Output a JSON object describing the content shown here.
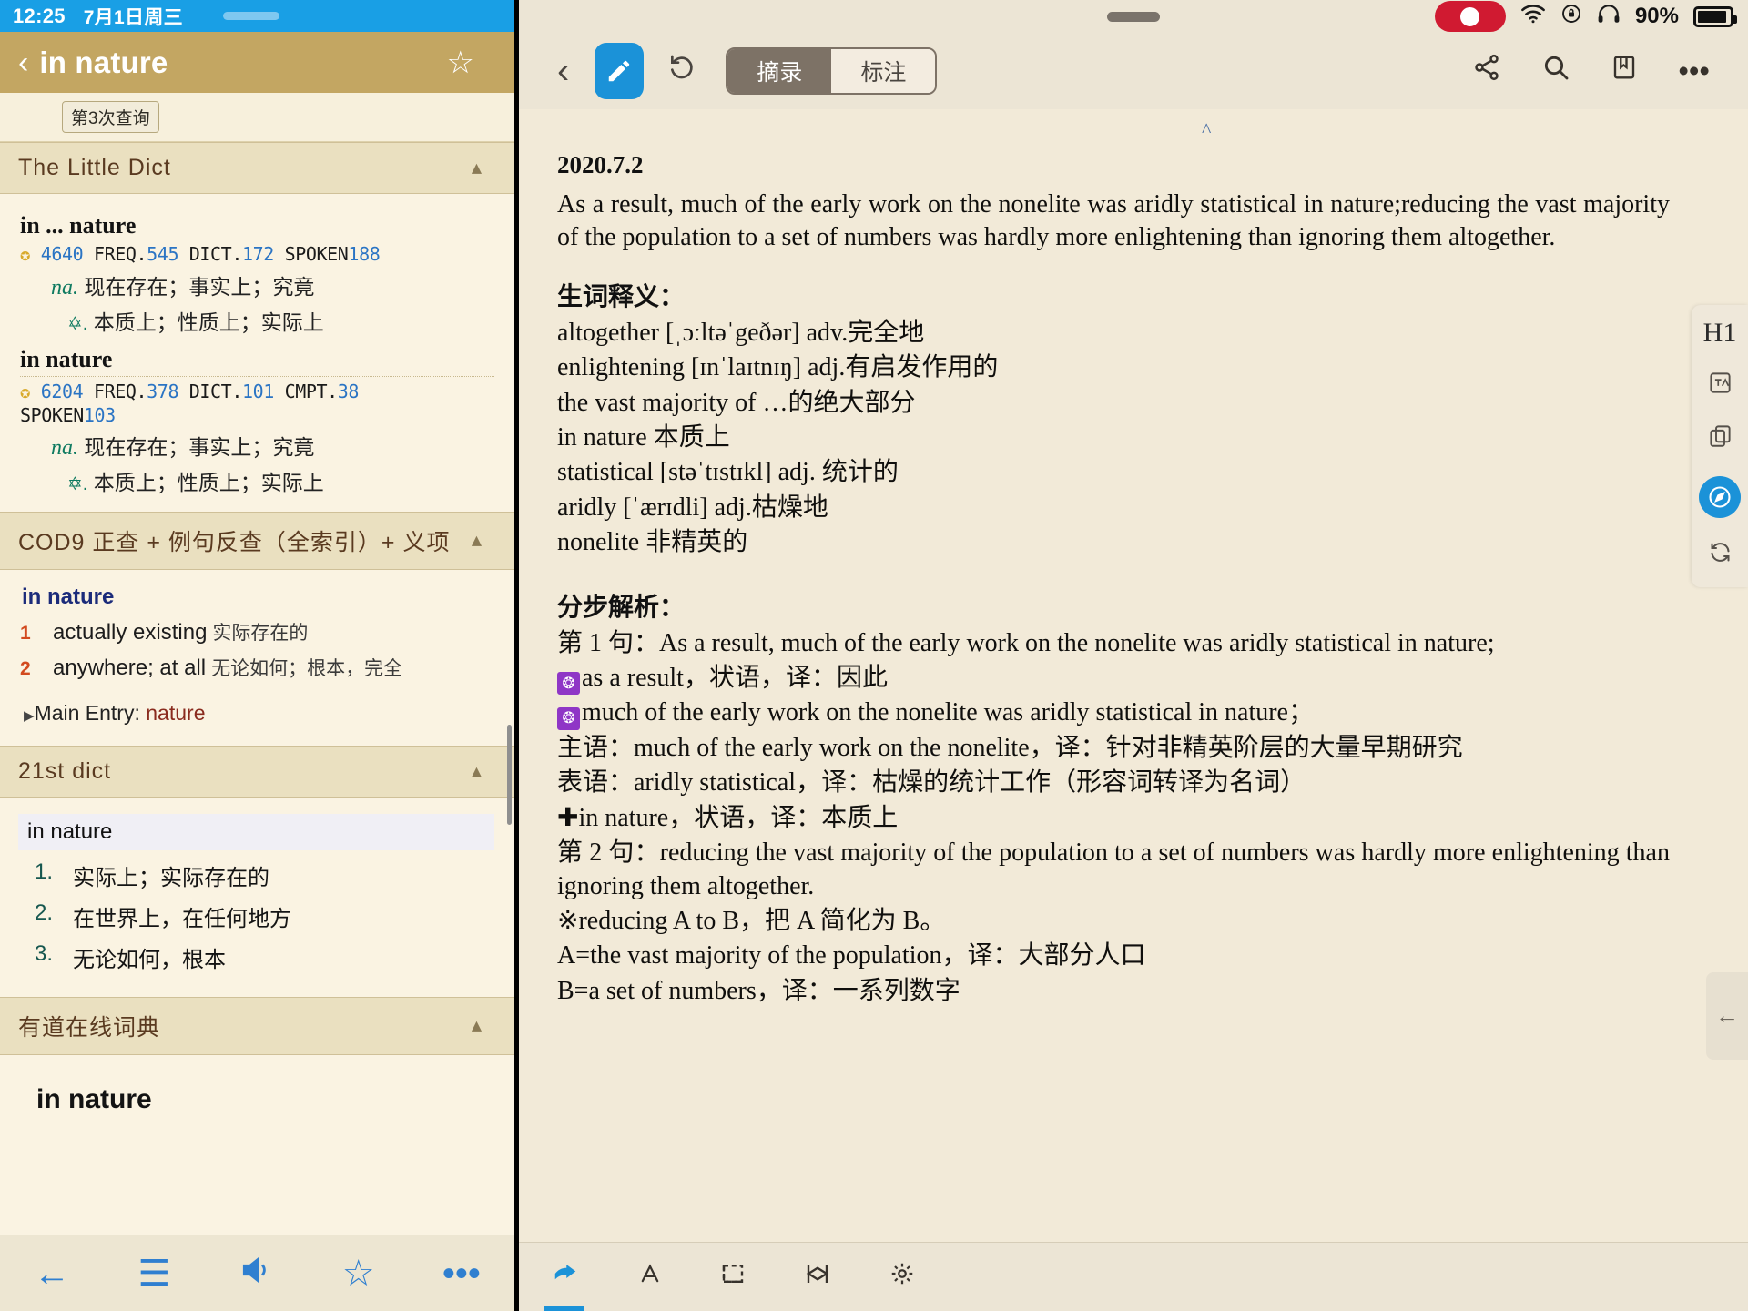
{
  "status_bar": {
    "time": "12:25",
    "date": "7月1日周三"
  },
  "dict_header": {
    "title": "in nature",
    "back_icon": "chevron-left-icon",
    "favorite_icon": "star-outline-icon"
  },
  "query": {
    "tag": "第3次查询"
  },
  "sections": [
    {
      "name": "little-dict",
      "title": "The Little Dict",
      "entries": [
        {
          "headword": "in ... nature",
          "freq": {
            "star": "4640",
            "items": [
              {
                "label": "FREQ.",
                "value": "545"
              },
              {
                "label": "DICT.",
                "value": "172"
              },
              {
                "label": "SPOKEN",
                "value": "188"
              }
            ]
          },
          "defs": [
            {
              "pos": "na.",
              "text": "现在存在；事实上；究竟"
            },
            {
              "pos": "✡.",
              "text": "本质上；性质上；实际上"
            }
          ]
        },
        {
          "headword": "in nature",
          "freq": {
            "star": "6204",
            "items": [
              {
                "label": "FREQ.",
                "value": "378"
              },
              {
                "label": "DICT.",
                "value": "101"
              },
              {
                "label": "CMPT.",
                "value": "38"
              },
              {
                "label": "SPOKEN",
                "value": "103"
              }
            ]
          },
          "defs": [
            {
              "pos": "na.",
              "text": "现在存在；事实上；究竟"
            },
            {
              "pos": "✡.",
              "text": "本质上；性质上；实际上"
            }
          ]
        }
      ]
    },
    {
      "name": "cod9",
      "title": "COD9 正查 + 例句反查（全索引）+ 义项",
      "headword": "in nature",
      "items": [
        {
          "num": "1",
          "en": "actually existing",
          "cn": "实际存在的"
        },
        {
          "num": "2",
          "en": "anywhere; at all",
          "cn": "无论如何；根本，完全"
        }
      ],
      "main_entry_label": "Main Entry:",
      "main_entry_word": "nature"
    },
    {
      "name": "dict-21st",
      "title": "21st dict",
      "headword": "in nature",
      "items": [
        {
          "num": "1.",
          "text": "实际上；实际存在的"
        },
        {
          "num": "2.",
          "text": "在世界上，在任何地方"
        },
        {
          "num": "3.",
          "text": "无论如何，根本"
        }
      ]
    },
    {
      "name": "youdao",
      "title": "有道在线词典",
      "headword": "in nature"
    }
  ],
  "bottom_nav": [
    {
      "name": "back-arrow-icon",
      "glyph": "←"
    },
    {
      "name": "list-icon",
      "glyph": "☰"
    },
    {
      "name": "speaker-icon",
      "glyph": "🔊"
    },
    {
      "name": "star-icon",
      "glyph": "☆"
    },
    {
      "name": "more-icon",
      "glyph": "•••"
    }
  ],
  "right_status": {
    "recording_label": "",
    "wifi_icon": "wifi-icon",
    "rotation_lock_icon": "rotation-lock-icon",
    "headphones_icon": "headphones-icon",
    "battery_percent": "90%"
  },
  "right_toolbar": {
    "back_icon": "chevron-left-icon",
    "pen_icon": "pencil-icon",
    "undo_icon": "undo-icon",
    "segments": [
      {
        "label": "摘录",
        "selected": true
      },
      {
        "label": "标注",
        "selected": false
      }
    ],
    "actions": [
      {
        "name": "share-icon",
        "glyph": "⇗"
      },
      {
        "name": "search-icon",
        "glyph": "⌕"
      },
      {
        "name": "bookmark-icon",
        "glyph": "❏"
      },
      {
        "name": "more-icon",
        "glyph": "•••"
      }
    ]
  },
  "document": {
    "date": "2020.7.2",
    "paragraph": "As a result, much of the early work on the nonelite was aridly statistical in nature;reducing the vast majority of the population to a set of numbers was hardly more enlightening than ignoring them altogether.",
    "vocab_heading": "生词释义：",
    "vocab": [
      "altogether [ˌɔːltəˈgeðər] adv.完全地",
      "enlightening [ɪnˈlaɪtnɪŋ] adj.有启发作用的",
      "the vast majority of    …的绝大部分",
      "in nature  本质上",
      "statistical [stəˈtɪstɪkl] adj.  统计的",
      "aridly [ˈærɪdli] adj.枯燥地",
      "nonelite  非精英的"
    ],
    "analysis_heading": "分步解析：",
    "analysis": [
      {
        "type": "plain",
        "text": "第 1 句：As a result, much of the early work on the nonelite was aridly statistical in nature;"
      },
      {
        "type": "flower",
        "text": "as a result，状语，译：因此"
      },
      {
        "type": "flower",
        "text": "much of the early work on the nonelite was aridly statistical in nature；"
      },
      {
        "type": "plain",
        "text": "主语：much of the early work on the nonelite，译：针对非精英阶层的大量早期研究"
      },
      {
        "type": "plain",
        "text": "表语：aridly statistical，译：枯燥的统计工作（形容词转译为名词）"
      },
      {
        "type": "cross",
        "text": "in nature，状语，译：本质上"
      },
      {
        "type": "justify",
        "text": "第 2 句：reducing the vast majority of the population to a set of numbers was hardly more enlightening than ignoring them altogether."
      },
      {
        "type": "plain",
        "text": "※reducing A to B，把 A 简化为 B。"
      },
      {
        "type": "plain",
        "text": "A=the vast majority of the population，译：大部分人口"
      },
      {
        "type": "plain",
        "text": "B=a set of numbers，译：一系列数字"
      }
    ]
  },
  "right_rail": {
    "label": "H1",
    "icons": [
      {
        "name": "translate-icon",
        "glyph": "⊞"
      },
      {
        "name": "copy-icon",
        "glyph": "⧉"
      },
      {
        "name": "compass-icon",
        "glyph": "➤",
        "active": true
      },
      {
        "name": "sync-icon",
        "glyph": "⟳"
      }
    ]
  },
  "page_flip": {
    "icon": "chevron-left-icon"
  },
  "right_bottom_tools": [
    {
      "name": "pointer-icon",
      "glyph": "☛",
      "selected": true
    },
    {
      "name": "text-style-icon",
      "glyph": "A"
    },
    {
      "name": "crop-icon",
      "glyph": "⌷"
    },
    {
      "name": "shape-icon",
      "glyph": "⋈"
    },
    {
      "name": "settings-icon",
      "glyph": "⚙"
    }
  ]
}
